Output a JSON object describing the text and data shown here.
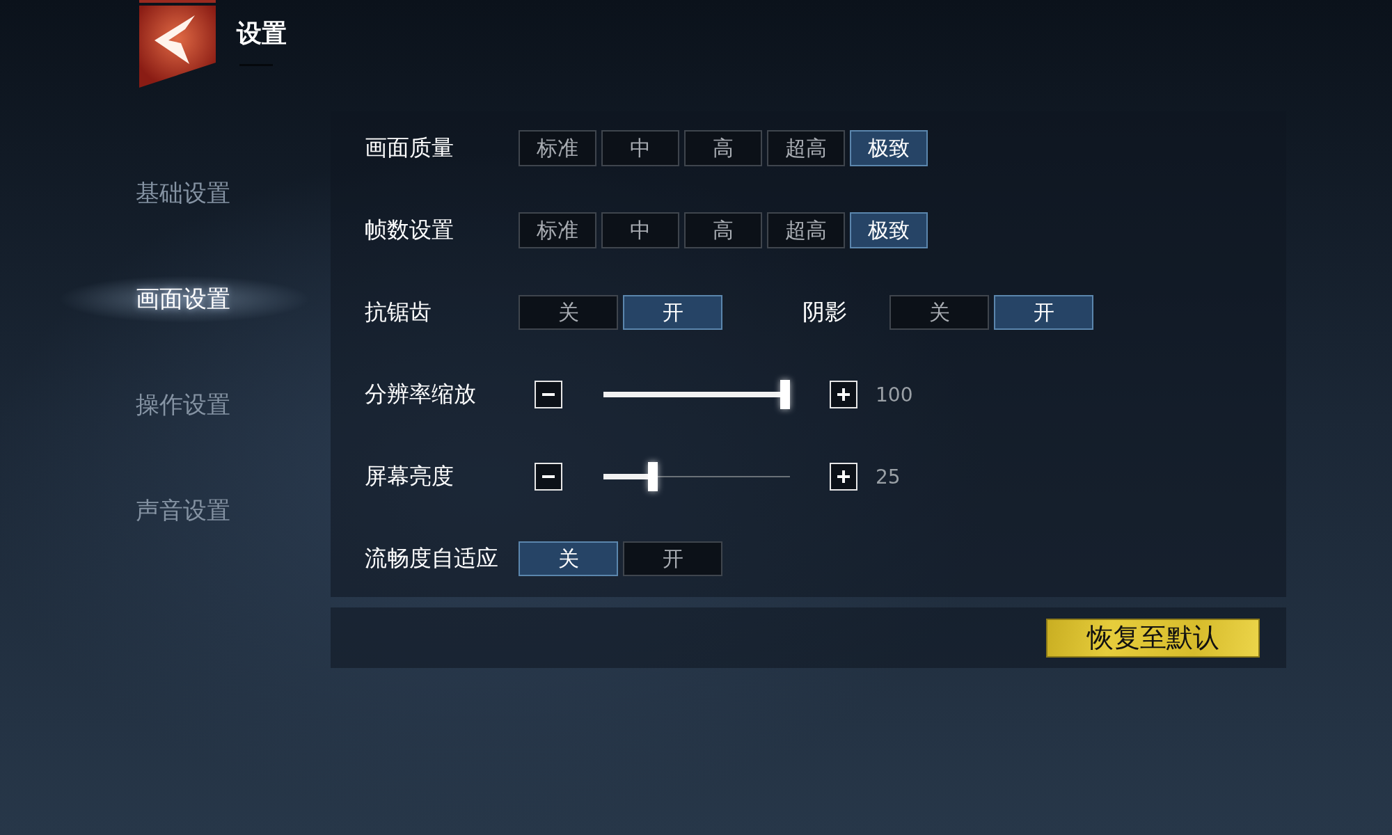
{
  "header": {
    "title": "设置"
  },
  "sidebar": {
    "items": [
      {
        "label": "基础设置",
        "selected": false
      },
      {
        "label": "画面设置",
        "selected": true
      },
      {
        "label": "操作设置",
        "selected": false
      },
      {
        "label": "声音设置",
        "selected": false
      }
    ]
  },
  "rows": [
    {
      "kind": "options",
      "label": "画面质量",
      "options": [
        {
          "label": "标准",
          "selected": false
        },
        {
          "label": "中",
          "selected": false
        },
        {
          "label": "高",
          "selected": false
        },
        {
          "label": "超高",
          "selected": false
        },
        {
          "label": "极致",
          "selected": true
        }
      ]
    },
    {
      "kind": "options",
      "label": "帧数设置",
      "options": [
        {
          "label": "标准",
          "selected": false
        },
        {
          "label": "中",
          "selected": false
        },
        {
          "label": "高",
          "selected": false
        },
        {
          "label": "超高",
          "selected": false
        },
        {
          "label": "极致",
          "selected": true
        }
      ]
    },
    {
      "kind": "toggles",
      "label": "抗锯齿",
      "options": [
        {
          "label": "关",
          "selected": false
        },
        {
          "label": "开",
          "selected": true
        }
      ],
      "second": {
        "label": "阴影",
        "options": [
          {
            "label": "关",
            "selected": false
          },
          {
            "label": "开",
            "selected": true
          }
        ]
      }
    },
    {
      "kind": "slider",
      "label": "分辨率缩放",
      "level": 1,
      "value": "100"
    },
    {
      "kind": "slider",
      "label": "屏幕亮度",
      "level": 0.25,
      "value": "25"
    },
    {
      "kind": "toggles",
      "label": "流畅度自适应",
      "options": [
        {
          "label": "关",
          "selected": true
        },
        {
          "label": "开",
          "selected": false
        }
      ]
    }
  ],
  "reset_button": {
    "label": "恢复至默认"
  }
}
